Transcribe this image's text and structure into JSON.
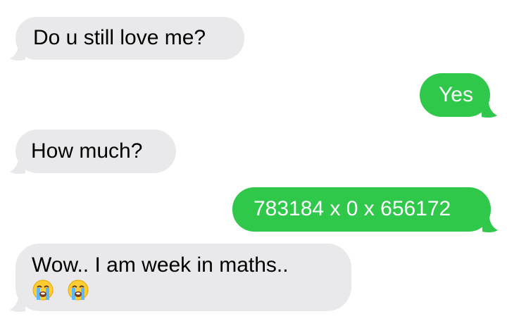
{
  "messages": [
    {
      "direction": "received",
      "text": "Do u still love me?"
    },
    {
      "direction": "sent",
      "text": "Yes"
    },
    {
      "direction": "received",
      "text": "How much?"
    },
    {
      "direction": "sent",
      "text": "783184 x 0 x 656172"
    },
    {
      "direction": "received",
      "text": "Wow.. I am week in maths..",
      "emoji_icons": [
        "loudly-crying-face-icon",
        "loudly-crying-face-icon"
      ]
    }
  ],
  "colors": {
    "received_bubble": "#e9e9eb",
    "sent_bubble": "#2fc84b",
    "received_text": "#000000",
    "sent_text": "#ffffff",
    "background": "#ffffff"
  }
}
